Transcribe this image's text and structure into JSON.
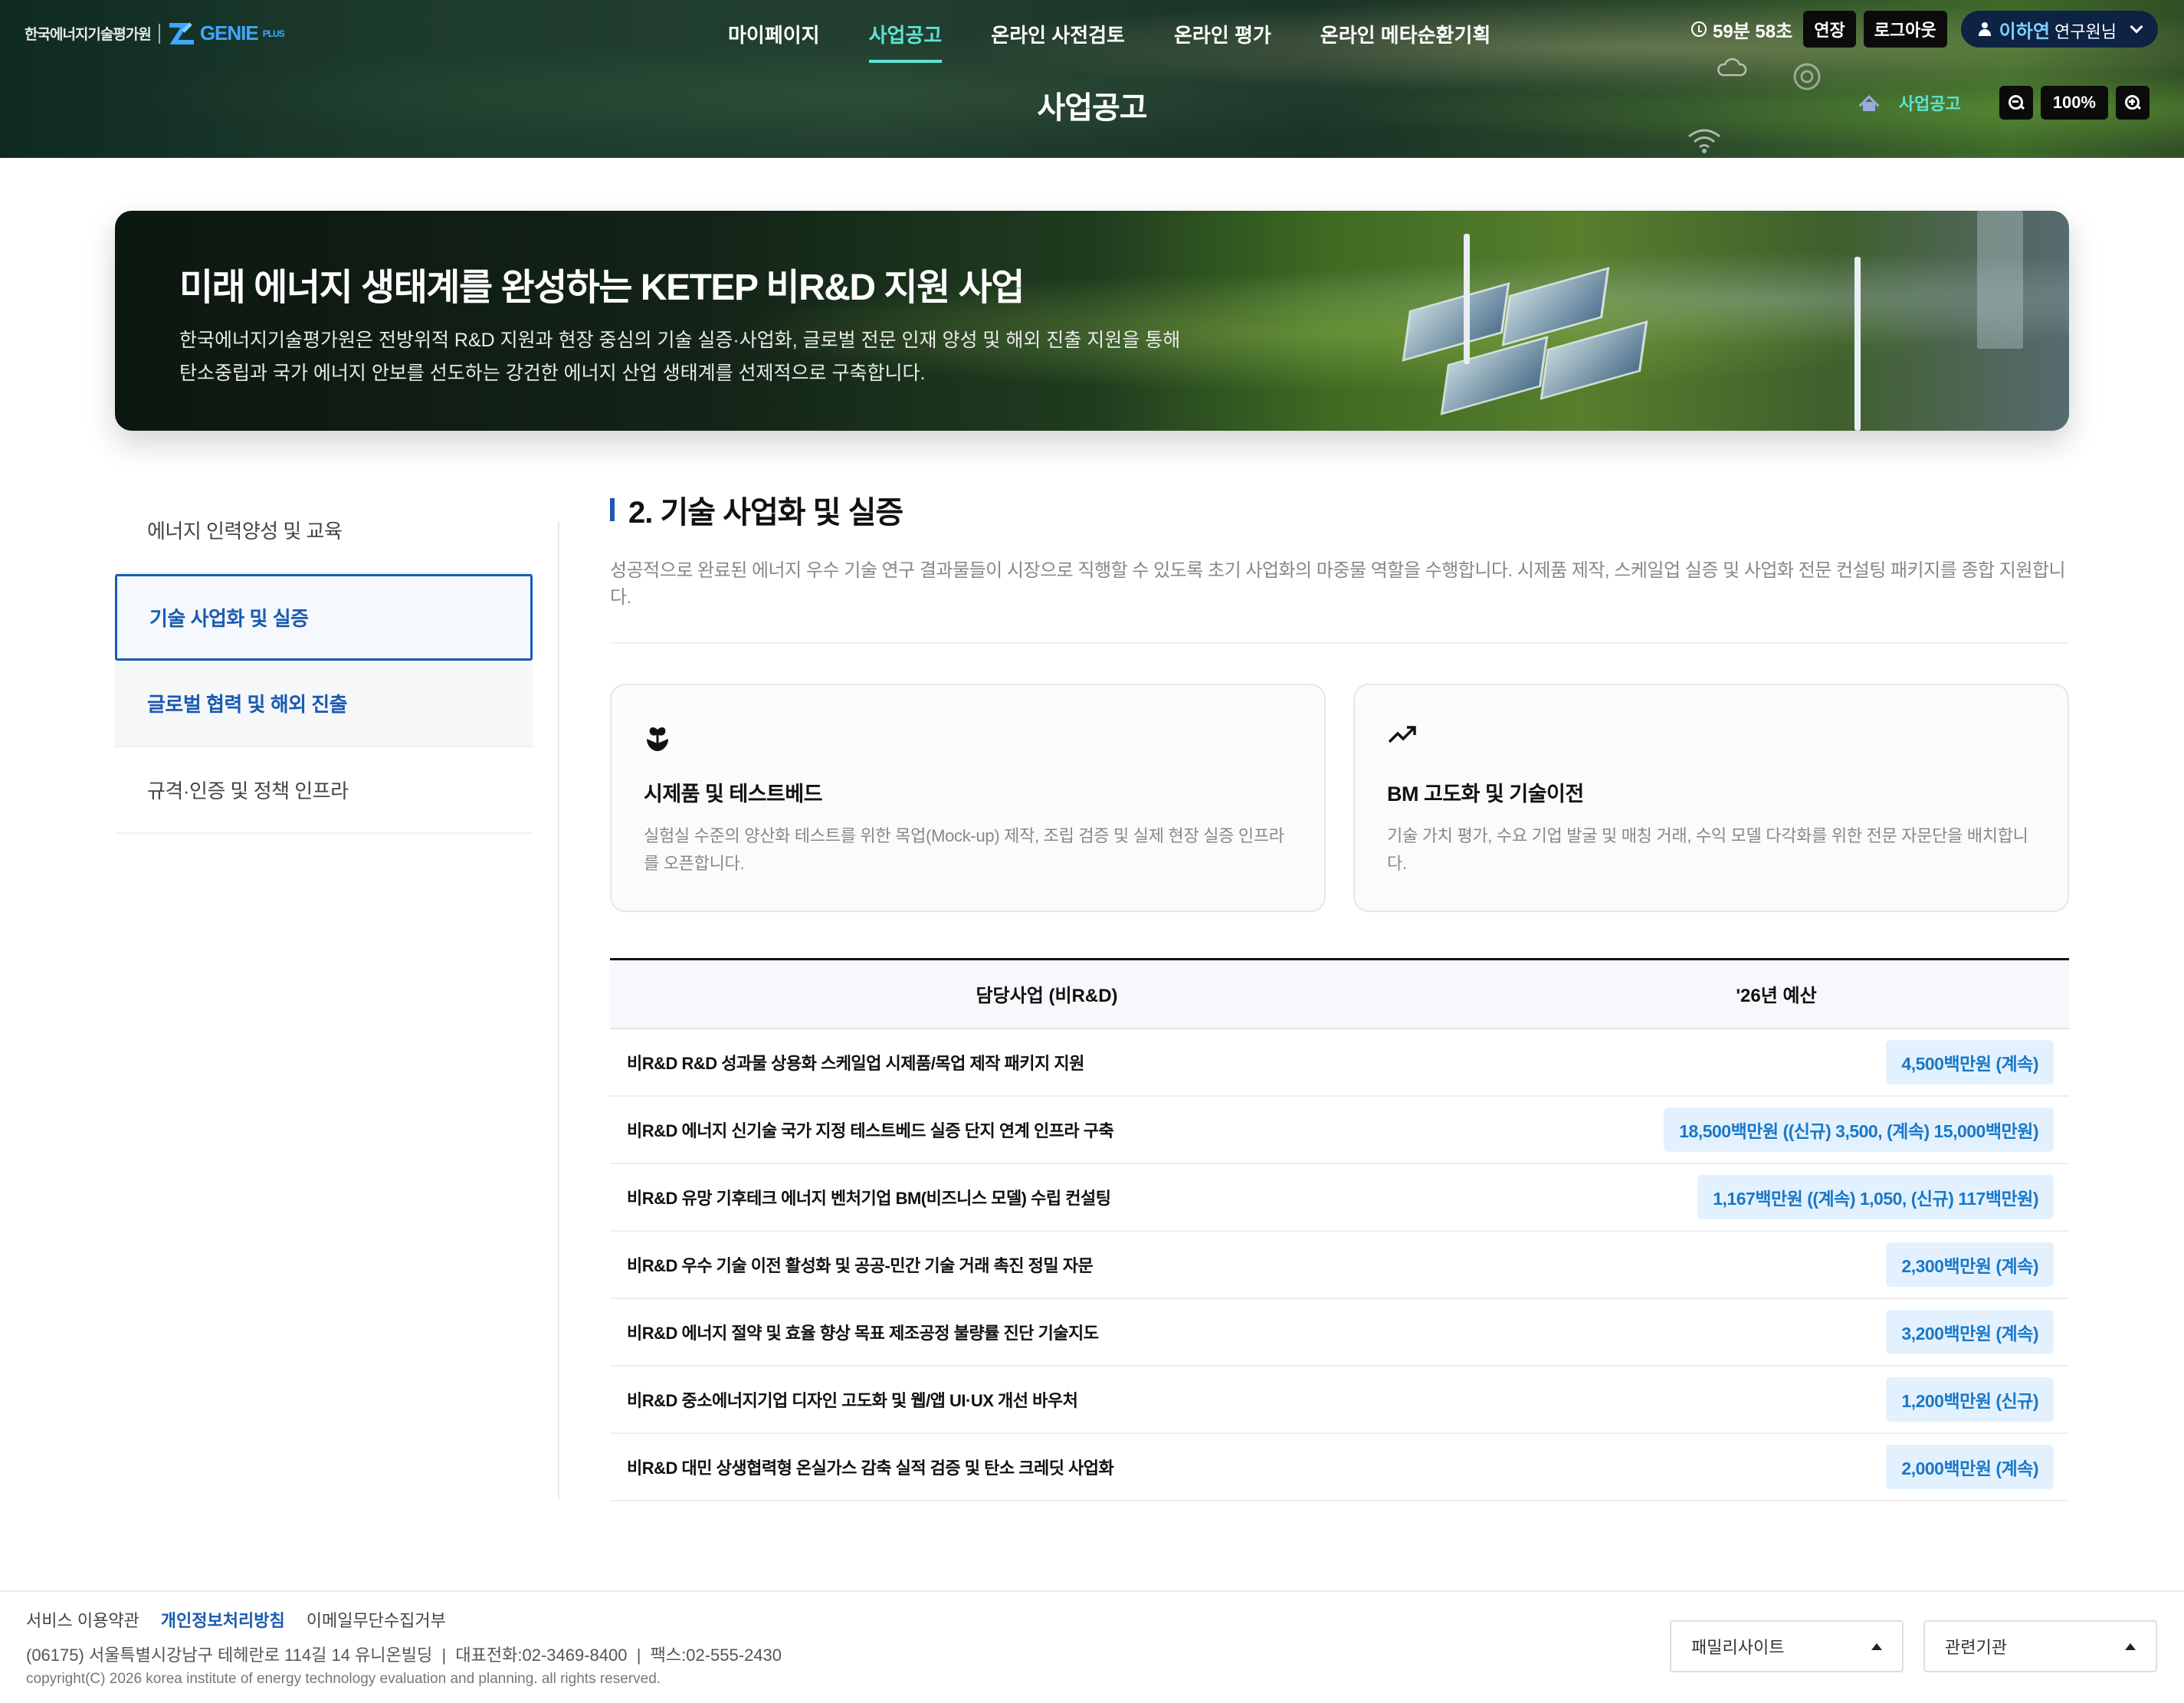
{
  "header": {
    "logo_kr": "한국에너지기술평가원",
    "logo_genie": "GENIE",
    "logo_plus": "PLUS",
    "nav": [
      "마이페이지",
      "사업공고",
      "온라인 사전검토",
      "온라인 평가",
      "온라인 메타순환기획"
    ],
    "timer": "59분 58초",
    "extend_label": "연장",
    "logout_label": "로그아웃",
    "user_name": "이하연",
    "user_suffix": "연구원님",
    "page_title": "사업공고",
    "breadcrumb_current": "사업공고",
    "zoom_level": "100%"
  },
  "banner": {
    "title": "미래 에너지 생태계를 완성하는 KETEP 비R&D 지원 사업",
    "desc_line1": "한국에너지기술평가원은 전방위적 R&D 지원과 현장 중심의 기술 실증·사업화, 글로벌 전문 인재 양성 및 해외 진출 지원을 통해",
    "desc_line2": "탄소중립과 국가 에너지 안보를 선도하는 강건한 에너지 산업 생태계를 선제적으로 구축합니다."
  },
  "sidebar": {
    "items": [
      {
        "label": "에너지 인력양성 및 교육"
      },
      {
        "label": "기술 사업화 및 실증"
      },
      {
        "label": "글로벌 협력 및 해외 진출"
      },
      {
        "label": "규격·인증 및 정책 인프라"
      }
    ]
  },
  "section": {
    "title": "2. 기술 사업화 및 실증",
    "desc": "성공적으로 완료된 에너지 우수 기술 연구 결과물들이 시장으로 직행할 수 있도록 초기 사업화의 마중물 역할을 수행합니다. 시제품 제작, 스케일업 실증 및 사업화 전문 컨설팅 패키지를 종합 지원합니다."
  },
  "cards": [
    {
      "icon": "sprout-icon",
      "title": "시제품 및 테스트베드",
      "desc": "실험실 수준의 양산화 테스트를 위한 목업(Mock-up) 제작, 조립 검증 및 실제 현장 실증 인프라를 오픈합니다."
    },
    {
      "icon": "trending-up-icon",
      "title": "BM 고도화 및 기술이전",
      "desc": "기술 가치 평가, 수요 기업 발굴 및 매칭 거래, 수익 모델 다각화를 위한 전문 자문단을 배치합니다."
    }
  ],
  "table": {
    "headers": [
      "담당사업 (비R&D)",
      "'26년 예산"
    ],
    "rows": [
      {
        "name": "비R&D R&D 성과물 상용화 스케일업 시제품/목업 제작 패키지 지원",
        "budget": "4,500백만원 (계속)"
      },
      {
        "name": "비R&D 에너지 신기술 국가 지정 테스트베드 실증 단지 연계 인프라 구축",
        "budget": "18,500백만원 ((신규) 3,500, (계속) 15,000백만원)"
      },
      {
        "name": "비R&D 유망 기후테크 에너지 벤처기업 BM(비즈니스 모델) 수립 컨설팅",
        "budget": "1,167백만원 ((계속) 1,050, (신규) 117백만원)"
      },
      {
        "name": "비R&D 우수 기술 이전 활성화 및 공공-민간 기술 거래 촉진 정밀 자문",
        "budget": "2,300백만원 (계속)"
      },
      {
        "name": "비R&D 에너지 절약 및 효율 향상 목표 제조공정 불량률 진단 기술지도",
        "budget": "3,200백만원 (계속)"
      },
      {
        "name": "비R&D 중소에너지기업 디자인 고도화 및 웹/앱 UI·UX 개선 바우처",
        "budget": "1,200백만원 (신규)"
      },
      {
        "name": "비R&D 대민 상생협력형 온실가스 감축 실적 검증 및 탄소 크레딧 사업화",
        "budget": "2,000백만원 (계속)"
      }
    ]
  },
  "footer": {
    "links": [
      "서비스 이용약관",
      "개인정보처리방침",
      "이메일무단수집거부"
    ],
    "address": "(06175) 서울특별시강남구 테헤란로 114길 14 유니온빌딩  |  대표전화:02-3469-8400  |  팩스:02-555-2430",
    "copyright": "copyright(C) 2026 korea institute of energy technology evaluation and planning. all rights reserved.",
    "family_site": "패밀리사이트",
    "related": "관련기관"
  },
  "colors": {
    "accent": "#1a5bb0",
    "nav_active": "#5fe3d5",
    "badge_bg": "#e3f1ff",
    "badge_text": "#1a78c8"
  }
}
